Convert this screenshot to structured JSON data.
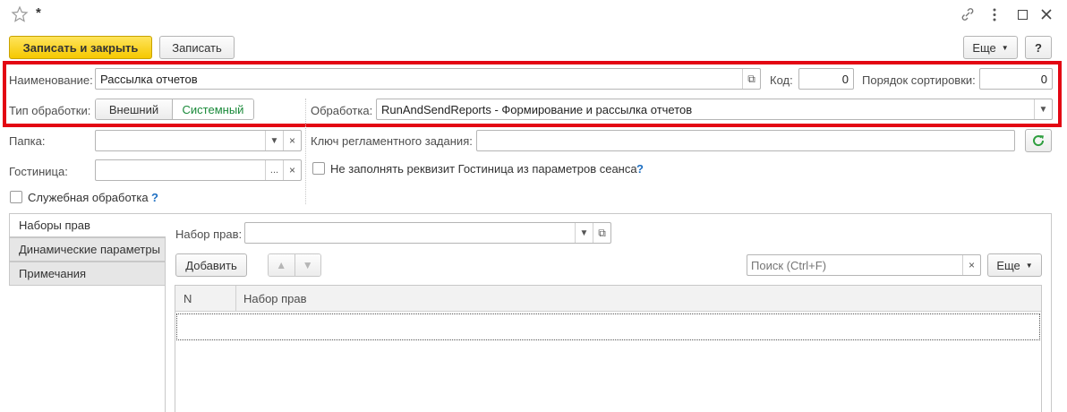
{
  "window": {
    "title": "*",
    "icons": [
      "star-icon",
      "link-icon",
      "more-icon",
      "restore-icon",
      "close-icon"
    ]
  },
  "toolbar": {
    "save_close": "Записать и закрыть",
    "save": "Записать",
    "more": "Еще",
    "help": "?"
  },
  "form": {
    "name_label": "Наименование:",
    "name_value": "Рассылка отчетов",
    "code_label": "Код:",
    "code_value": "0",
    "sort_label": "Порядок сортировки:",
    "sort_value": "0",
    "type_label": "Тип обработки:",
    "type_external": "Внешний",
    "type_system": "Системный",
    "processing_label": "Обработка:",
    "processing_value": "RunAndSendReports - Формирование и рассылка отчетов",
    "folder_label": "Папка:",
    "hotel_label": "Гостиница:",
    "job_key_label": "Ключ регламентного задания:",
    "no_fill_label": "Не заполнять реквизит Гостиница из параметров сеанса",
    "service_label": "Служебная обработка",
    "help_mark": "?"
  },
  "tabs": [
    {
      "label": "Наборы прав"
    },
    {
      "label": "Динамические параметры"
    },
    {
      "label": "Примечания"
    }
  ],
  "rights": {
    "set_label": "Набор прав:",
    "add_button": "Добавить",
    "search_placeholder": "Поиск (Ctrl+F)",
    "more": "Еще",
    "columns": [
      "N",
      "Набор прав"
    ]
  },
  "colors": {
    "highlight": "#e30613",
    "primary": "#f5c800",
    "system_active": "#1a8a3a",
    "refresh": "#2e9e3e"
  }
}
